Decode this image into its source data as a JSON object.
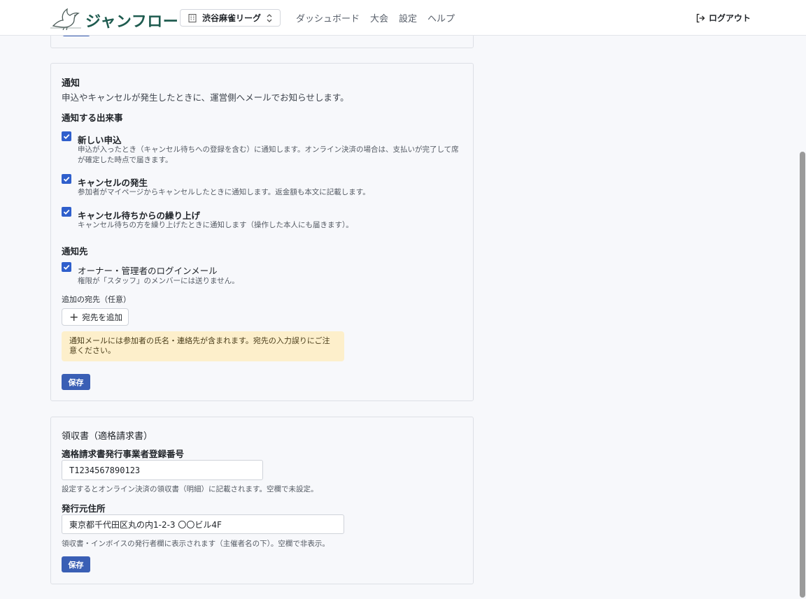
{
  "header": {
    "logo_text": "ジャンフロー",
    "org_select": "渋谷麻雀リーグ",
    "nav": [
      "ダッシュボード",
      "大会",
      "設定",
      "ヘルプ"
    ],
    "logout": "ログアウト"
  },
  "notify": {
    "title": "通知",
    "description": "申込やキャンセルが発生したときに、運営側へメールでお知らせします。",
    "events_heading": "通知する出来事",
    "events": [
      {
        "label": "新しい申込",
        "help": "申込が入ったとき（キャンセル待ちへの登録を含む）に通知します。オンライン決済の場合は、支払いが完了して席が確定した時点で届きます。",
        "checked": true
      },
      {
        "label": "キャンセルの発生",
        "help": "参加者がマイページからキャンセルしたときに通知します。返金額も本文に記載します。",
        "checked": true
      },
      {
        "label": "キャンセル待ちからの繰り上げ",
        "help": "キャンセル待ちの方を繰り上げたときに通知します（操作した本人にも届きます）。",
        "checked": true
      }
    ],
    "recipients_heading": "通知先",
    "owner_option": {
      "label": "オーナー・管理者のログインメール",
      "help": "権限が「スタッフ」のメンバーには送りません。",
      "checked": true
    },
    "extra_label": "追加の宛先（任意）",
    "add_button": "宛先を追加",
    "warning": "通知メールには参加者の氏名・連絡先が含まれます。宛先の入力誤りにご注意ください。",
    "save": "保存"
  },
  "receipt": {
    "title": "領収書（適格請求書）",
    "reg_label": "適格請求書発行事業者登録番号",
    "reg_value": "T1234567890123",
    "reg_help": "設定するとオンライン決済の領収書（明細）に記載されます。空欄で未設定。",
    "addr_label": "発行元住所",
    "addr_value": "東京都千代田区丸の内1-2-3 〇〇ビル4F",
    "addr_help": "領収書・インボイスの発行者欄に表示されます（主催者名の下）。空欄で非表示。",
    "save": "保存"
  },
  "colors": {
    "brand": "#1e5b4f",
    "primary": "#3a5fb5",
    "checkbox": "#2f5fcc",
    "warning_bg": "#fdefcb"
  }
}
